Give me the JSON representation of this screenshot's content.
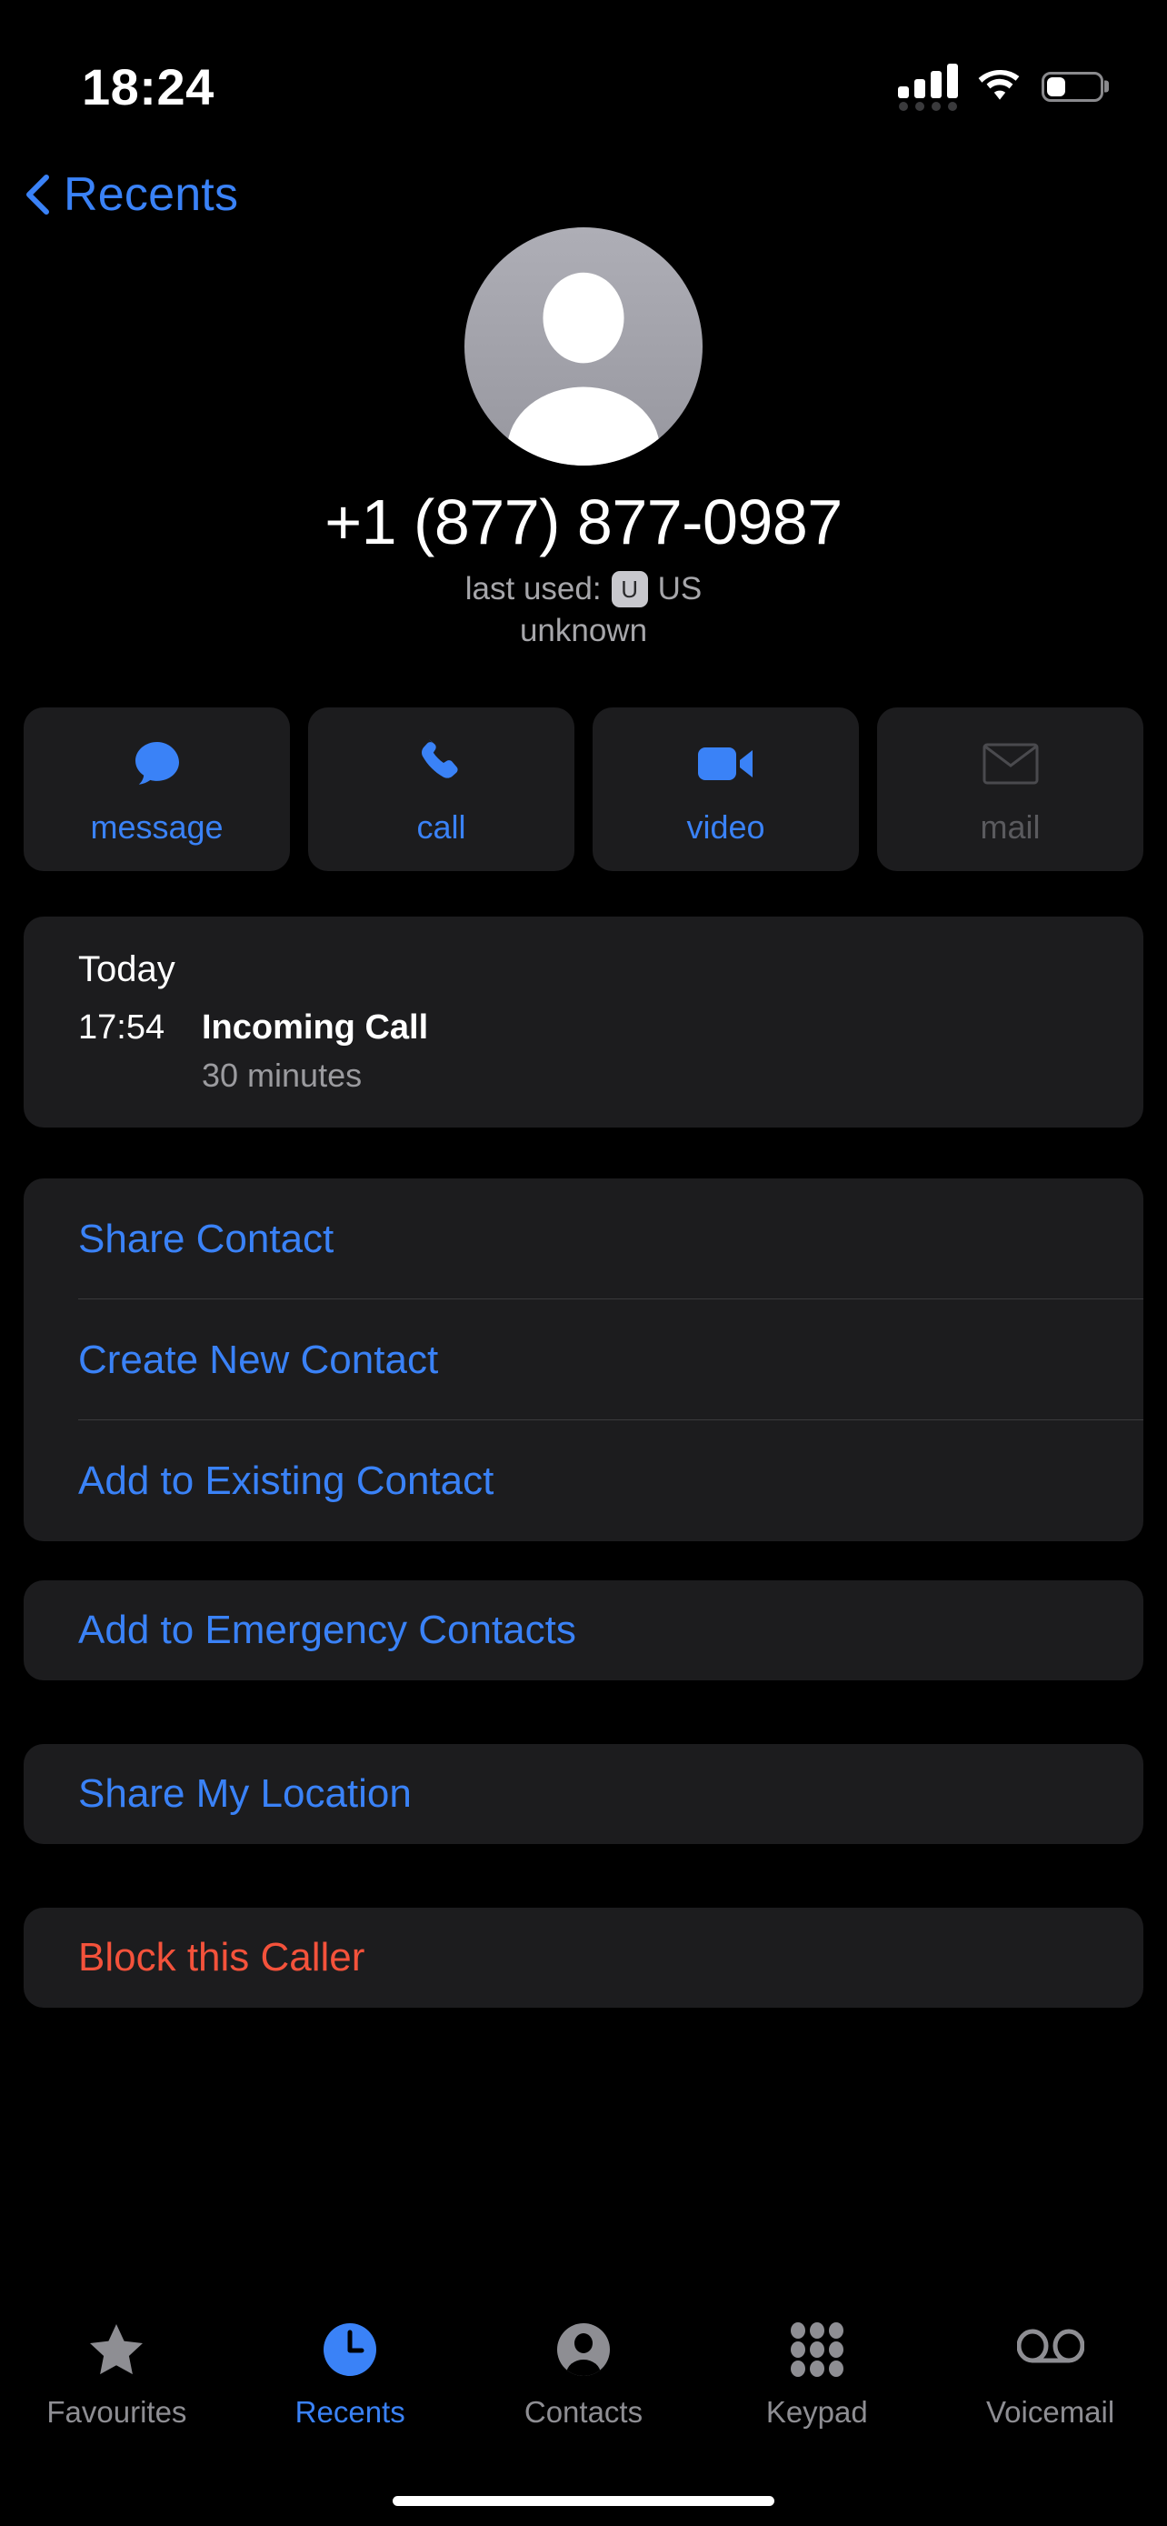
{
  "status_bar": {
    "time": "18:24",
    "signal_icon": "cellular-signal-icon",
    "signal_bars": 4,
    "wifi_icon": "wifi-icon",
    "battery_icon": "battery-icon",
    "battery_level_percent": 35
  },
  "nav": {
    "back_icon": "chevron-left-icon",
    "back_label": "Recents"
  },
  "header": {
    "avatar_icon": "person-avatar-icon",
    "phone_number": "+1 (877) 877-0987",
    "last_used_label": "last used:",
    "carrier_badge": "U",
    "country": "US",
    "caller_label": "unknown"
  },
  "quick_actions": [
    {
      "label": "message",
      "icon": "message-bubble-icon",
      "enabled": true
    },
    {
      "label": "call",
      "icon": "phone-icon",
      "enabled": true
    },
    {
      "label": "video",
      "icon": "video-camera-icon",
      "enabled": true
    },
    {
      "label": "mail",
      "icon": "envelope-icon",
      "enabled": false
    }
  ],
  "call_history": {
    "day_label": "Today",
    "time": "17:54",
    "type": "Incoming Call",
    "duration": "30 minutes"
  },
  "contact_actions": [
    {
      "label": "Share Contact"
    },
    {
      "label": "Create New Contact"
    },
    {
      "label": "Add to Existing Contact"
    }
  ],
  "emergency_action": {
    "label": "Add to Emergency Contacts"
  },
  "location_action": {
    "label": "Share My Location"
  },
  "block_action": {
    "label": "Block this Caller"
  },
  "tabs": [
    {
      "label": "Favourites",
      "icon": "star-icon",
      "active": false
    },
    {
      "label": "Recents",
      "icon": "clock-icon",
      "active": true
    },
    {
      "label": "Contacts",
      "icon": "person-icon",
      "active": false
    },
    {
      "label": "Keypad",
      "icon": "keypad-icon",
      "active": false
    },
    {
      "label": "Voicemail",
      "icon": "voicemail-icon",
      "active": false
    }
  ],
  "colors": {
    "accent_blue": "#3a82f7",
    "danger_red": "#f4523b",
    "card_bg": "#1c1c1e",
    "page_bg": "#000000",
    "secondary_text": "#8e8e93"
  }
}
